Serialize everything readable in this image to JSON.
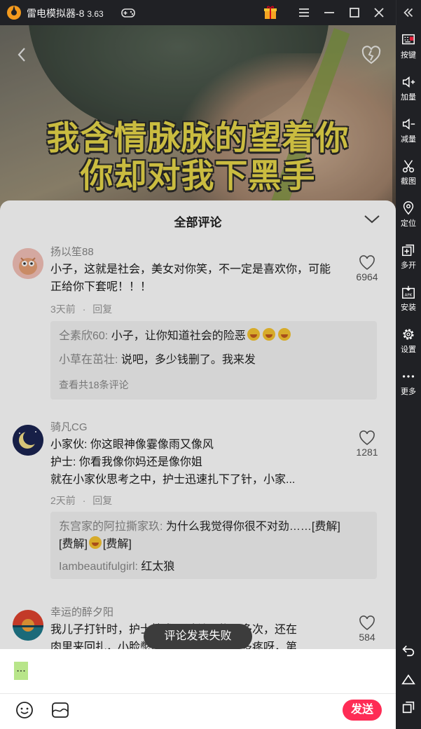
{
  "window": {
    "title": "雷电模拟器-8",
    "version": "3.63"
  },
  "sidebar": {
    "items": [
      {
        "label": "按键",
        "icon": "keyboard-icon"
      },
      {
        "label": "加量",
        "icon": "volume-up-icon"
      },
      {
        "label": "减量",
        "icon": "volume-down-icon"
      },
      {
        "label": "截图",
        "icon": "scissors-icon"
      },
      {
        "label": "定位",
        "icon": "location-pin-icon"
      },
      {
        "label": "多开",
        "icon": "multi-instance-icon"
      },
      {
        "label": "安装",
        "icon": "apk-install-icon"
      },
      {
        "label": "设置",
        "icon": "gear-icon"
      },
      {
        "label": "更多",
        "icon": "more-dots-icon"
      }
    ]
  },
  "video": {
    "caption_line1": "我含情脉脉的望着你",
    "caption_line2": "你却对我下黑手"
  },
  "comments_panel": {
    "title": "全部评论",
    "comments": [
      {
        "user": "扬以笙88",
        "text": "小子，这就是社会，美女对你笑，不一定是喜欢你，可能正给你下套呢！！！",
        "time": "3天前",
        "reply_label": "回复",
        "likes": "6964",
        "replies": [
          {
            "name": "仝素欣60:",
            "text": "小子，让你知道社会的险恶"
          },
          {
            "name": "小草在茁壮:",
            "text": "说吧，多少钱删了。我来发"
          }
        ],
        "more_replies": "查看共18条评论"
      },
      {
        "user": "骑凡CG",
        "text_lines": [
          "小家伙: 你这眼神像霎像雨又像风",
          "护士: 你看我像你妈还是像你姐",
          "就在小家伙思考之中，护士迅速扎下了针，小家..."
        ],
        "time": "2天前",
        "reply_label": "回复",
        "likes": "1281",
        "replies": [
          {
            "name": "东宫家的阿拉撕家玖:",
            "text": "为什么我觉得你很不对劲……[费解]"
          },
          {
            "text2": "[费解]"
          },
          {
            "name": "Iambeautifulgirl:",
            "text": "红太狼"
          }
        ]
      },
      {
        "user": "幸运的醉夕阳",
        "text_lines": [
          "我儿子打针时，护士技术不过关，扎了多次，还在",
          "肉里来回扎，小脸憋的通红都没哭，得多疼呀，第"
        ],
        "likes": "584"
      }
    ]
  },
  "input": {
    "value": "...",
    "send_label": "发送"
  },
  "toast": {
    "message": "评论发表失败"
  },
  "colors": {
    "accent": "#fe2c55",
    "emulator_chrome": "#202125"
  }
}
